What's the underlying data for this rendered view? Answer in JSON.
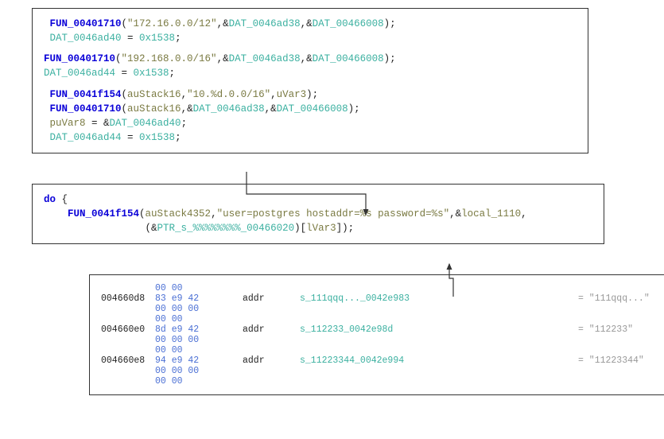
{
  "box1": {
    "b1": {
      "l1a": "FUN_00401710",
      "l1b": "(",
      "l1c": "\"172.16.0.0/12\"",
      "l1d": ",&",
      "l1e": "DAT_0046ad38",
      "l1f": ",&",
      "l1g": "DAT_00466008",
      "l1h": ");",
      "l2a": "DAT_0046ad40",
      "l2b": " = ",
      "l2c": "0x1538",
      "l2d": ";"
    },
    "b2": {
      "l1a": "FUN_00401710",
      "l1b": "(",
      "l1c": "\"192.168.0.0/16\"",
      "l1d": ",&",
      "l1e": "DAT_0046ad38",
      "l1f": ",&",
      "l1g": "DAT_00466008",
      "l1h": ");",
      "l2a": "DAT_0046ad44",
      "l2b": " = ",
      "l2c": "0x1538",
      "l2d": ";"
    },
    "b3": {
      "l1a": "FUN_0041f154",
      "l1b": "(",
      "l1c": "auStack16",
      "l1d": ",",
      "l1e": "\"10.%d.0.0/16\"",
      "l1f": ",",
      "l1g": "uVar3",
      "l1h": ");",
      "l2a": "FUN_00401710",
      "l2b": "(",
      "l2c": "auStack16",
      "l2d": ",&",
      "l2e": "DAT_0046ad38",
      "l2f": ",&",
      "l2g": "DAT_00466008",
      "l2h": ");",
      "l3a": "puVar8",
      "l3b": " = &",
      "l3c": "DAT_0046ad40",
      "l3d": ";",
      "l4a": "DAT_0046ad44",
      "l4b": " = ",
      "l4c": "0x1538",
      "l4d": ";"
    }
  },
  "box2": {
    "l1a": "do",
    "l1b": " {",
    "l2a": "FUN_0041f154",
    "l2b": "(",
    "l2c": "auStack4352",
    "l2d": ",",
    "l2e": "\"user=postgres hostaddr=%s password=%s\"",
    "l2f": ",&",
    "l2g": "local_1110",
    "l2h": ",",
    "l3a": "(&",
    "l3b": "PTR_s_%%%%%%%%_00466020",
    "l3c": ")[",
    "l3d": "lVar3",
    "l3e": "]);"
  },
  "box3": {
    "pre1": "00 00",
    "r1": {
      "addr": "004660d8",
      "b1": "83 e9 42",
      "b2": "00 00 00",
      "b3": "00 00",
      "type": "addr",
      "label": "s_111qqq..._0042e983",
      "val": "= \"111qqq...\""
    },
    "r2": {
      "addr": "004660e0",
      "b1": "8d e9 42",
      "b2": "00 00 00",
      "b3": "00 00",
      "type": "addr",
      "label": "s_112233_0042e98d",
      "val": "= \"112233\""
    },
    "r3": {
      "addr": "004660e8",
      "b1": "94 e9 42",
      "b2": "00 00 00",
      "b3": "00 00",
      "type": "addr",
      "label": "s_11223344_0042e994",
      "val": "= \"11223344\""
    }
  }
}
